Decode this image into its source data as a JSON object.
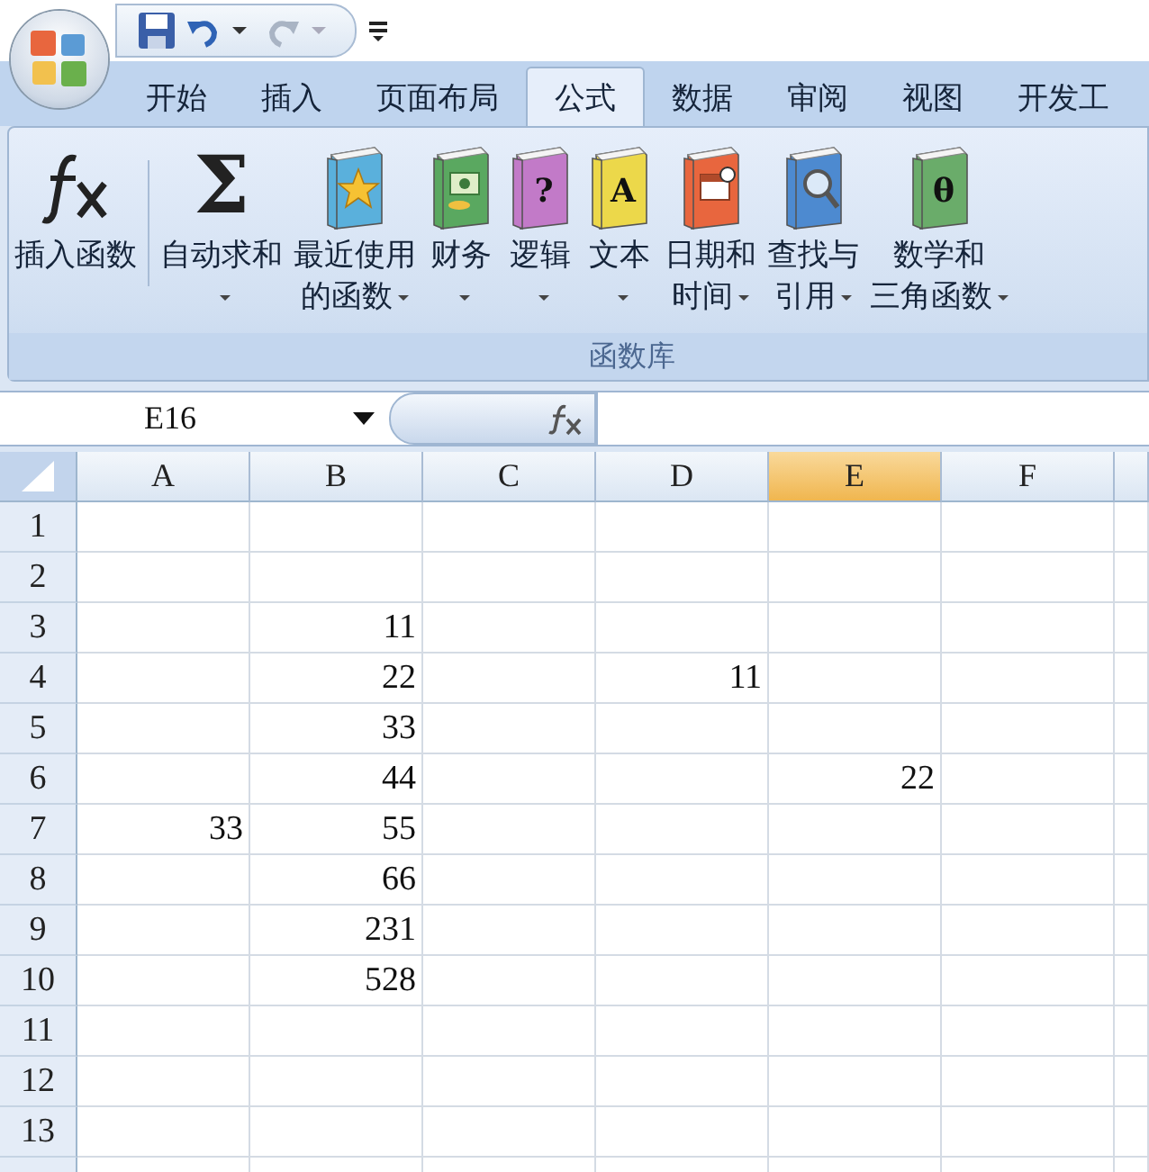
{
  "quick_access": {
    "redo_disabled": true
  },
  "tabs": [
    {
      "label": "开始",
      "selected": false
    },
    {
      "label": "插入",
      "selected": false
    },
    {
      "label": "页面布局",
      "selected": false
    },
    {
      "label": "公式",
      "selected": true
    },
    {
      "label": "数据",
      "selected": false
    },
    {
      "label": "审阅",
      "selected": false
    },
    {
      "label": "视图",
      "selected": false
    },
    {
      "label": "开发工",
      "selected": false
    }
  ],
  "ribbon": {
    "group_label": "函数库",
    "buttons": [
      {
        "lines": [
          "插入函数"
        ],
        "dropdown": false,
        "icon": {
          "kind": "fx"
        },
        "separator_after": true
      },
      {
        "lines": [
          "自动求和"
        ],
        "dropdown": true,
        "icon": {
          "kind": "sigma",
          "glyph": "Σ"
        },
        "separator_after": false
      },
      {
        "lines": [
          "最近使用",
          "的函数"
        ],
        "dropdown": true,
        "icon": {
          "kind": "star",
          "color": "#5ab0dc"
        },
        "separator_after": false
      },
      {
        "lines": [
          "财务"
        ],
        "dropdown": true,
        "icon": {
          "kind": "money",
          "color": "#5aa860"
        },
        "separator_after": false
      },
      {
        "lines": [
          "逻辑"
        ],
        "dropdown": true,
        "icon": {
          "kind": "glyph",
          "color": "#c27ac8",
          "glyph": "?"
        },
        "separator_after": false
      },
      {
        "lines": [
          "文本"
        ],
        "dropdown": true,
        "icon": {
          "kind": "glyph",
          "color": "#ecd84a",
          "glyph": "A"
        },
        "separator_after": false
      },
      {
        "lines": [
          "日期和",
          "时间"
        ],
        "dropdown": true,
        "icon": {
          "kind": "calendar",
          "color": "#e8663e"
        },
        "separator_after": false
      },
      {
        "lines": [
          "查找与",
          "引用"
        ],
        "dropdown": true,
        "icon": {
          "kind": "magnifier",
          "color": "#4d8ad0"
        },
        "separator_after": false
      },
      {
        "lines": [
          "数学和",
          "三角函数"
        ],
        "dropdown": true,
        "icon": {
          "kind": "glyph",
          "color": "#6aac6a",
          "glyph": "θ"
        },
        "separator_after": false
      }
    ]
  },
  "formula_bar": {
    "name_box": "E16"
  },
  "columns": [
    {
      "label": "A",
      "selected": false
    },
    {
      "label": "B",
      "selected": false
    },
    {
      "label": "C",
      "selected": false
    },
    {
      "label": "D",
      "selected": false
    },
    {
      "label": "E",
      "selected": true
    },
    {
      "label": "F",
      "selected": false
    }
  ],
  "rows": [
    {
      "label": "1",
      "cells": []
    },
    {
      "label": "2",
      "cells": []
    },
    {
      "label": "3",
      "cells": [
        null,
        "11"
      ]
    },
    {
      "label": "4",
      "cells": [
        null,
        "22",
        null,
        "11"
      ]
    },
    {
      "label": "5",
      "cells": [
        null,
        "33"
      ]
    },
    {
      "label": "6",
      "cells": [
        null,
        "44",
        null,
        null,
        "22"
      ]
    },
    {
      "label": "7",
      "cells": [
        "33",
        "55"
      ]
    },
    {
      "label": "8",
      "cells": [
        null,
        "66"
      ]
    },
    {
      "label": "9",
      "cells": [
        null,
        "231"
      ]
    },
    {
      "label": "10",
      "cells": [
        null,
        "528"
      ]
    },
    {
      "label": "11",
      "cells": []
    },
    {
      "label": "12",
      "cells": []
    },
    {
      "label": "13",
      "cells": []
    }
  ]
}
